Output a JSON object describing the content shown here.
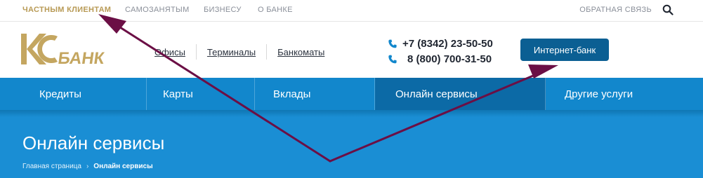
{
  "top_nav": {
    "items": [
      "ЧАСТНЫМ КЛИЕНТАМ",
      "САМОЗАНЯТЫМ",
      "БИЗНЕСУ",
      "О БАНКЕ"
    ],
    "feedback": "ОБРАТНАЯ СВЯЗЬ",
    "search_icon": "search-icon"
  },
  "header": {
    "logo": {
      "letters": "К",
      "word": "БАНК"
    },
    "links": [
      "Офисы",
      "Терминалы",
      "Банкоматы"
    ],
    "phones": [
      "+7 (8342) 23-50-50",
      "8 (800) 700-31-50"
    ],
    "phone_icon": "phone-icon",
    "internet_bank": "Интернет-банк"
  },
  "main_nav": {
    "items": [
      "Кредиты",
      "Карты",
      "Вклады",
      "Онлайн сервисы",
      "Другие услуги"
    ],
    "active": "Онлайн сервисы"
  },
  "hero": {
    "title": "Онлайн сервисы",
    "breadcrumb": [
      "Главная страница",
      "Онлайн сервисы"
    ]
  },
  "colors": {
    "accent_gold": "#b89a55",
    "brand_blue": "#1287cc",
    "button_blue": "#0b5f93",
    "annotation_arrow": "#6b0f45"
  }
}
